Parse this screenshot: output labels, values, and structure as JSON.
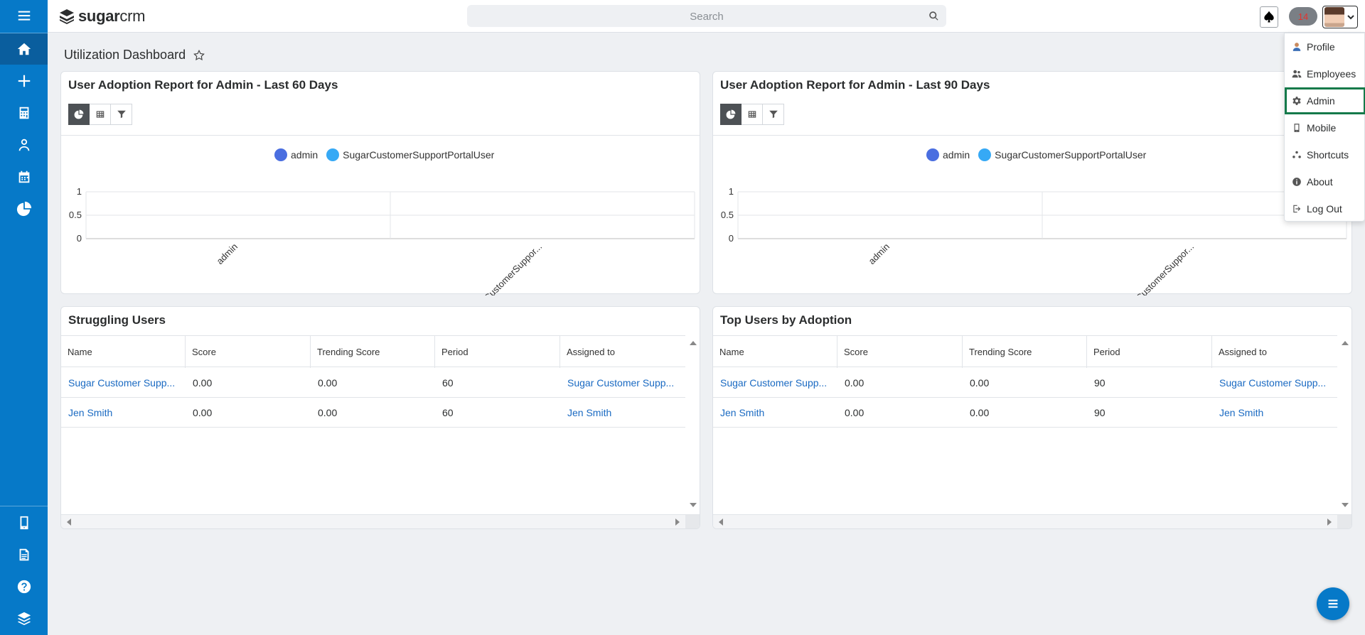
{
  "app": {
    "brand_bold": "sugar",
    "brand_light": "crm"
  },
  "search": {
    "placeholder": "Search"
  },
  "header": {
    "notification_count": "14"
  },
  "page": {
    "title": "Utilization Dashboard"
  },
  "colors": {
    "sidebar": "#0679c8",
    "series_admin": "#4a6ee0",
    "series_portal": "#36a9f5",
    "link": "#1a6ac2",
    "highlight": "#157a4a"
  },
  "sidebar_icons": [
    "menu-icon",
    "home-icon",
    "plus-icon",
    "calculator-icon",
    "contacts-icon",
    "calendar-icon",
    "pie-chart-icon",
    "mobile-icon",
    "document-icon",
    "help-icon",
    "layers-icon"
  ],
  "dashlets": {
    "adoption60": {
      "title": "User Adoption Report for Admin - Last 60 Days",
      "legend": [
        "admin",
        "SugarCustomerSupportPortalUser"
      ],
      "xticks": [
        "admin",
        "SugarCustomerSuppor..."
      ],
      "yticks": [
        "1",
        "0.5",
        "0"
      ]
    },
    "adoption90": {
      "title": "User Adoption Report for Admin - Last 90 Days",
      "legend": [
        "admin",
        "SugarCustomerSupportPortalUser"
      ],
      "xticks": [
        "admin",
        "SugarCustomerSuppor..."
      ],
      "yticks": [
        "1",
        "0.5",
        "0"
      ]
    },
    "struggling": {
      "title": "Struggling Users",
      "columns": [
        "Name",
        "Score",
        "Trending Score",
        "Period",
        "Assigned to"
      ],
      "rows": [
        [
          "Sugar Customer Supp...",
          "0.00",
          "0.00",
          "60",
          "Sugar Customer Supp..."
        ],
        [
          "Jen Smith",
          "0.00",
          "0.00",
          "60",
          "Jen Smith"
        ]
      ]
    },
    "top": {
      "title": "Top Users by Adoption",
      "columns": [
        "Name",
        "Score",
        "Trending Score",
        "Period",
        "Assigned to"
      ],
      "rows": [
        [
          "Sugar Customer Supp...",
          "0.00",
          "0.00",
          "90",
          "Sugar Customer Supp..."
        ],
        [
          "Jen Smith",
          "0.00",
          "0.00",
          "90",
          "Jen Smith"
        ]
      ]
    }
  },
  "chart_data": [
    {
      "type": "bar",
      "title": "User Adoption Report for Admin - Last 60 Days",
      "categories": [
        "admin",
        "SugarCustomerSuppor..."
      ],
      "series": [
        {
          "name": "admin",
          "values": [
            0,
            0
          ]
        },
        {
          "name": "SugarCustomerSupportPortalUser",
          "values": [
            0,
            0
          ]
        }
      ],
      "ylim": [
        0,
        1
      ],
      "yticks": [
        0,
        0.5,
        1
      ],
      "legend": "top-center",
      "grid": true
    },
    {
      "type": "bar",
      "title": "User Adoption Report for Admin - Last 90 Days",
      "categories": [
        "admin",
        "SugarCustomerSuppor..."
      ],
      "series": [
        {
          "name": "admin",
          "values": [
            0,
            0
          ]
        },
        {
          "name": "SugarCustomerSupportPortalUser",
          "values": [
            0,
            0
          ]
        }
      ],
      "ylim": [
        0,
        1
      ],
      "yticks": [
        0,
        0.5,
        1
      ],
      "legend": "top-center",
      "grid": true
    }
  ],
  "user_menu": {
    "items": [
      "Profile",
      "Employees",
      "Admin",
      "Mobile",
      "Shortcuts",
      "About",
      "Log Out"
    ],
    "highlighted": "Admin"
  }
}
